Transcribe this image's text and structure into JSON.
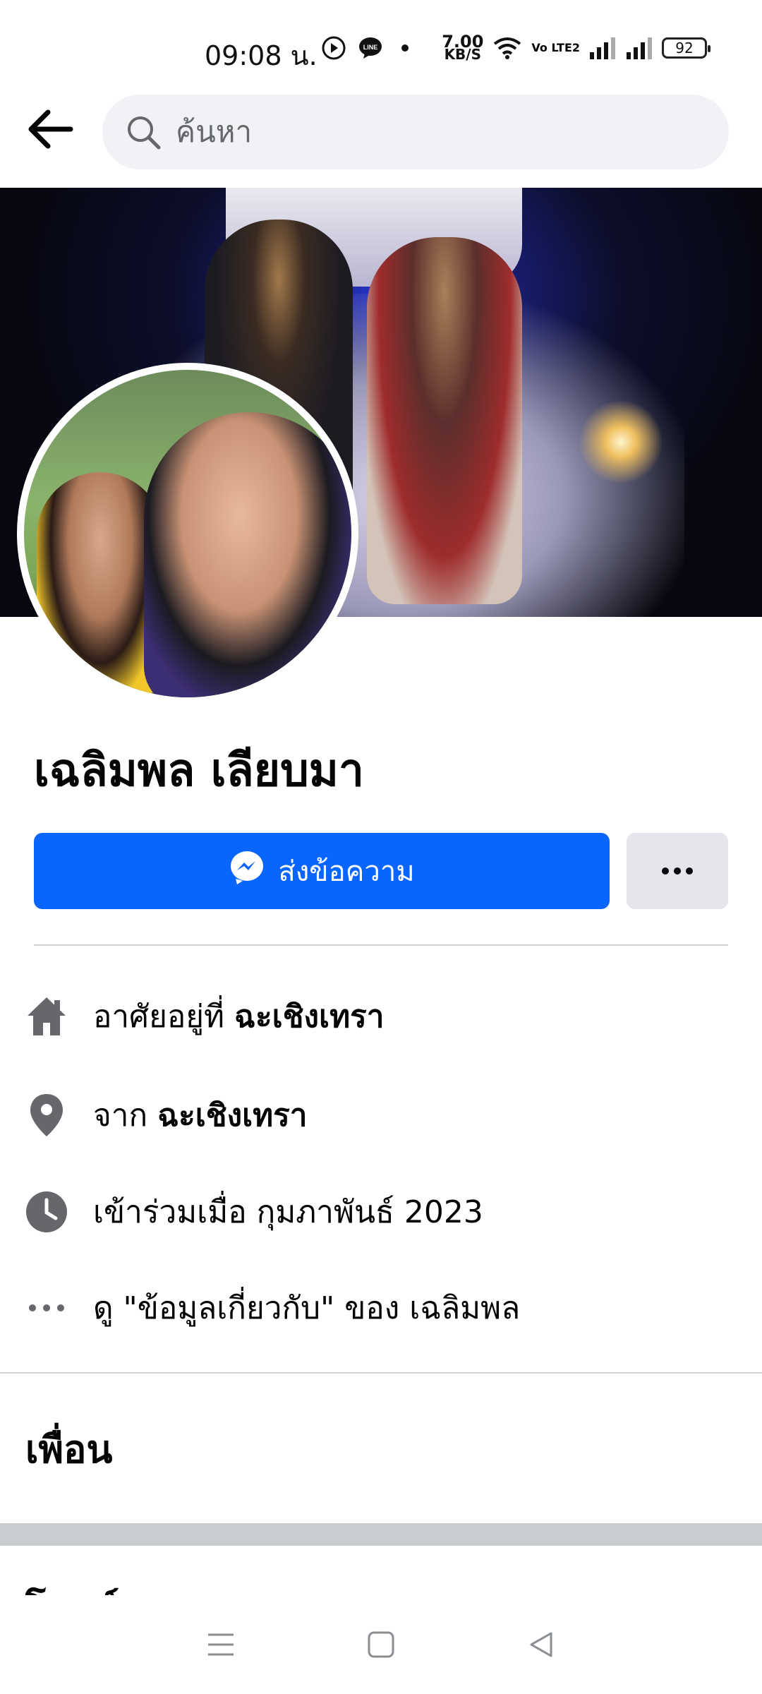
{
  "status_bar": {
    "time": "09:08 น.",
    "network_speed_value": "7.00",
    "network_speed_unit": "KB/S",
    "volte_label": "Vo LTE2",
    "battery": "92"
  },
  "search": {
    "placeholder": "ค้นหา"
  },
  "profile": {
    "name": "เฉลิมพล เลียบมา"
  },
  "actions": {
    "message_label": "ส่งข้อความ"
  },
  "details": {
    "lives_prefix": "อาศัยอยู่ที่ ",
    "lives_value": "ฉะเชิงเทรา",
    "from_prefix": "จาก ",
    "from_value": "ฉะเชิงเทรา",
    "joined": "เข้าร่วมเมื่อ กุมภาพันธ์ 2023",
    "about_link": "ดู \"ข้อมูลเกี่ยวกับ\" ของ เฉลิมพล"
  },
  "sections": {
    "friends_title": "เพื่อน",
    "posts_title": "โพสต์"
  },
  "colors": {
    "accent": "#0866ff",
    "search_bg": "#f0f2f5",
    "secondary_button": "#e4e6eb",
    "icon_gray": "#65676b"
  },
  "icons": [
    "back-arrow-icon",
    "search-icon",
    "messenger-icon",
    "more-dots-icon",
    "home-icon",
    "location-pin-icon",
    "clock-icon",
    "ellipsis-icon",
    "menu-icon",
    "home-square-icon",
    "back-triangle-icon"
  ]
}
